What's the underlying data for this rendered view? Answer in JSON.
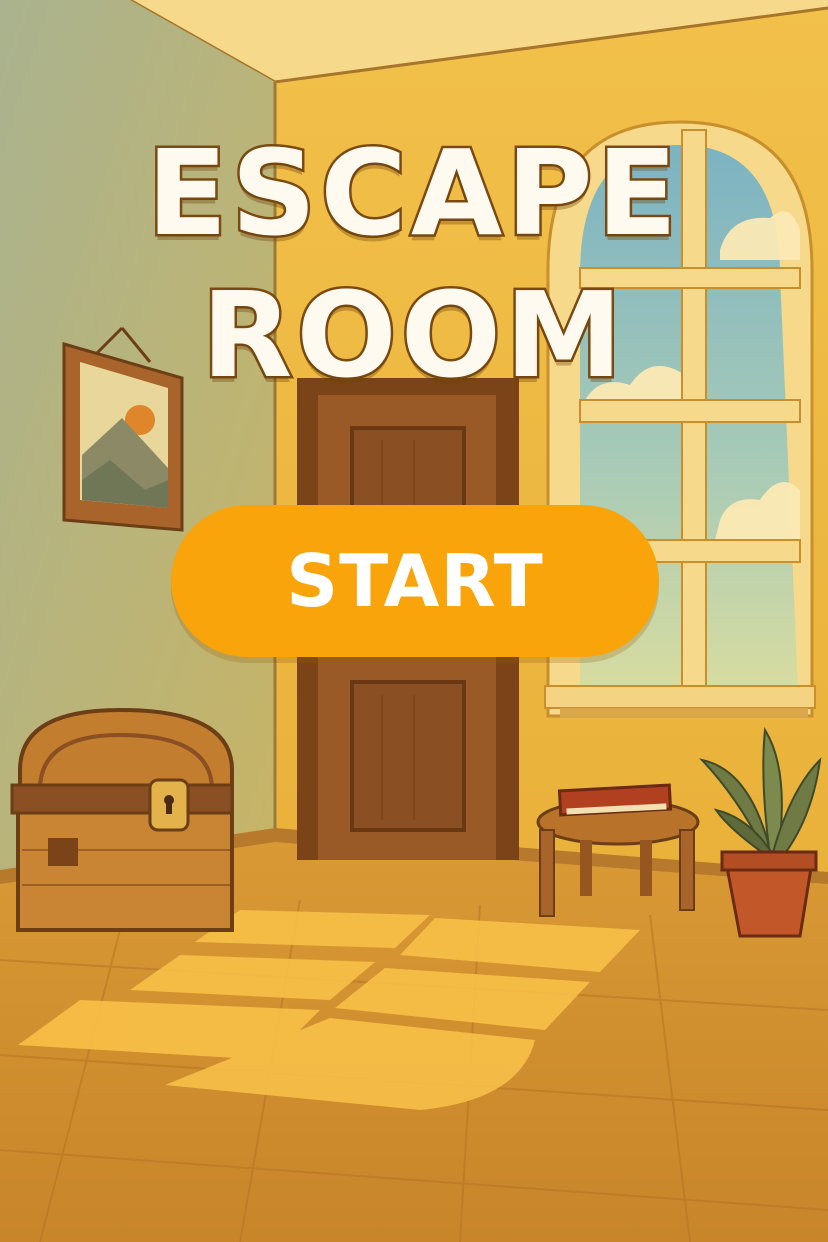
{
  "title": {
    "line1": "ESCAPE",
    "line2": "ROOM"
  },
  "start_button": {
    "label": "START"
  },
  "colors": {
    "button": "#f8a40a",
    "title_text": "#fffaf0",
    "title_outline": "#7a4a12",
    "wall_left": "#b7b98a",
    "wall_back": "#f0c44e",
    "floor": "#d3912e",
    "door": "#8a4f22"
  }
}
